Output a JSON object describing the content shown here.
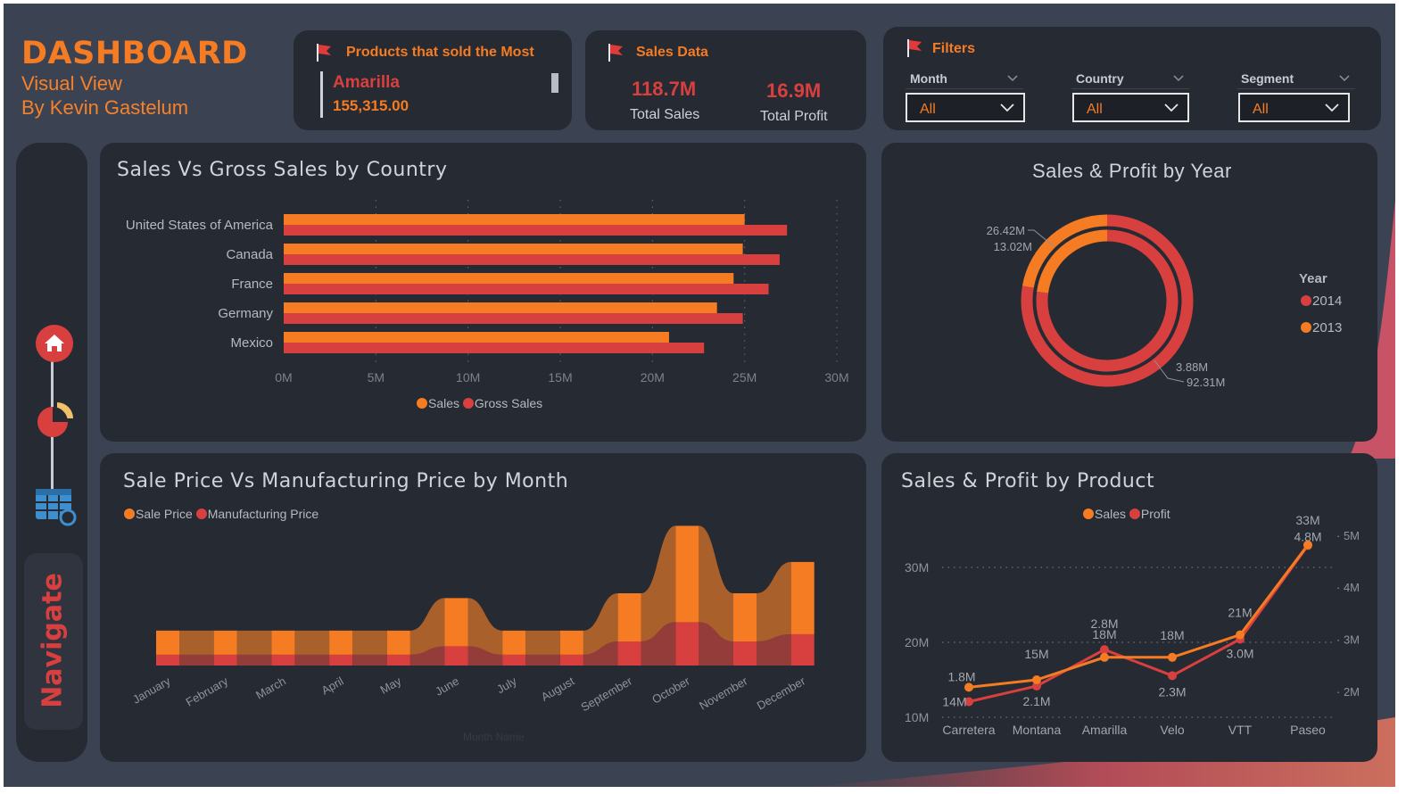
{
  "header": {
    "title": "DASHBOARD",
    "subtitle_line1": "Visual View",
    "subtitle_line2": "By Kevin Gastelum"
  },
  "top_product_card": {
    "title": "Products that sold the Most",
    "product": "Amarilla",
    "value": "155,315.00"
  },
  "sales_card": {
    "title": "Sales Data",
    "total_sales_value": "118.7M",
    "total_sales_label": "Total Sales",
    "total_profit_value": "16.9M",
    "total_profit_label": "Total Profit"
  },
  "filters": {
    "title": "Filters",
    "items": [
      {
        "label": "Month",
        "value": "All"
      },
      {
        "label": "Country",
        "value": "All"
      },
      {
        "label": "Segment",
        "value": "All"
      }
    ]
  },
  "navigation": {
    "label": "Navigate",
    "items": [
      {
        "icon": "home-icon"
      },
      {
        "icon": "pie-chart-icon"
      },
      {
        "icon": "table-search-icon"
      }
    ]
  },
  "colors": {
    "accent_orange": "#f57c23",
    "accent_red": "#d8403f",
    "background": "#3b4352",
    "panel": "#262a33"
  },
  "chart_data": [
    {
      "id": "country_bars",
      "type": "bar",
      "orientation": "horizontal",
      "title": "Sales Vs Gross Sales by Country",
      "categories": [
        "United States of America",
        "Canada",
        "France",
        "Germany",
        "Mexico"
      ],
      "series": [
        {
          "name": "Sales",
          "color": "#f57c23",
          "values": [
            25.0,
            24.9,
            24.4,
            23.5,
            20.9
          ]
        },
        {
          "name": "Gross Sales",
          "color": "#d8403f",
          "values": [
            27.3,
            26.9,
            26.3,
            24.9,
            22.8
          ]
        }
      ],
      "xlim": [
        0,
        30
      ],
      "x_ticks": [
        "0M",
        "5M",
        "10M",
        "15M",
        "20M",
        "25M",
        "30M"
      ],
      "grid": true,
      "legend": "bottom"
    },
    {
      "id": "year_donut",
      "type": "pie",
      "style": "nested-donut",
      "title": "Sales & Profit by Year",
      "legend_title": "Year",
      "legend": [
        {
          "name": "2014",
          "color": "#d8403f"
        },
        {
          "name": "2013",
          "color": "#f57c23"
        }
      ],
      "rings": [
        {
          "ring": "outer",
          "slices": [
            {
              "year": "2014",
              "value": 92.31
            },
            {
              "year": "2013",
              "value": 26.42
            }
          ]
        },
        {
          "ring": "inner",
          "slices": [
            {
              "year": "2014",
              "value": 13.02
            },
            {
              "year": "2013",
              "value": 3.88
            }
          ]
        }
      ],
      "data_labels": [
        "26.42M",
        "13.02M",
        "3.88M",
        "92.31M"
      ]
    },
    {
      "id": "month_ribbon",
      "type": "area",
      "style": "ribbon",
      "title": "Sale Price Vs Manufacturing Price by Month",
      "xlabel": "Month Name",
      "categories": [
        "January",
        "February",
        "March",
        "April",
        "May",
        "June",
        "July",
        "August",
        "September",
        "October",
        "November",
        "December"
      ],
      "series": [
        {
          "name": "Sale Price",
          "color": "#f57c23",
          "values": [
            1.0,
            1.0,
            1.0,
            1.0,
            1.0,
            2.0,
            1.0,
            1.0,
            2.0,
            4.0,
            2.0,
            3.0
          ]
        },
        {
          "name": "Manufacturing Price",
          "color": "#d8403f",
          "values": [
            0.45,
            0.45,
            0.45,
            0.45,
            0.45,
            0.8,
            0.45,
            0.45,
            1.0,
            1.8,
            1.0,
            1.3
          ]
        }
      ],
      "legend": "top-left"
    },
    {
      "id": "product_lines",
      "type": "line",
      "title": "Sales & Profit by Product",
      "categories": [
        "Carretera",
        "Montana",
        "Amarilla",
        "Velo",
        "VTT",
        "Paseo"
      ],
      "series": [
        {
          "name": "Sales",
          "color": "#f57c23",
          "axis": "left",
          "values": [
            14,
            15,
            18,
            18,
            21,
            33
          ],
          "labels": [
            "14M",
            "15M",
            "18M",
            "18M",
            "21M",
            "33M"
          ]
        },
        {
          "name": "Profit",
          "color": "#d8403f",
          "axis": "right",
          "values": [
            1.8,
            2.1,
            2.8,
            2.3,
            3.0,
            4.8
          ],
          "labels": [
            "1.8M",
            "2.1M",
            "2.8M",
            "2.3M",
            "3.0M",
            "4.8M"
          ]
        }
      ],
      "y_left": {
        "ticks": [
          "10M",
          "20M",
          "30M"
        ],
        "range": [
          10,
          35
        ]
      },
      "y_right": {
        "ticks": [
          "2M",
          "3M",
          "4M",
          "5M"
        ],
        "range": [
          1.5,
          5.1
        ]
      },
      "grid": true,
      "legend": "top"
    }
  ]
}
